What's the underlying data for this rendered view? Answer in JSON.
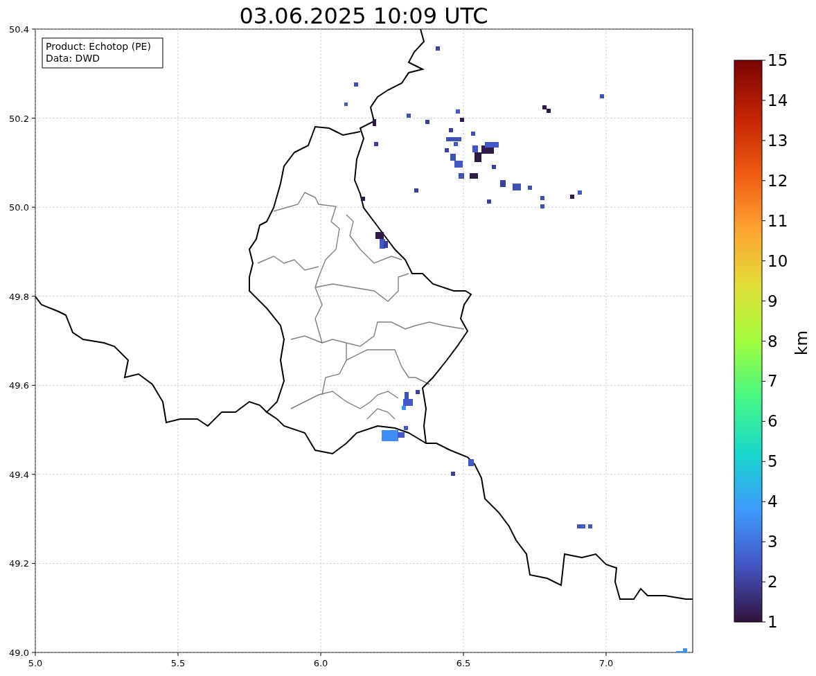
{
  "title": "03.06.2025 10:09 UTC",
  "info_box": [
    "Product: Echotop (PE)",
    "Data: DWD"
  ],
  "map": {
    "x_ticks": [
      "5.0",
      "5.5",
      "6.0",
      "6.5",
      "7.0"
    ],
    "y_ticks": [
      "50.4",
      "50.2",
      "50.0",
      "49.8",
      "49.6",
      "49.4",
      "49.2",
      "49.0"
    ]
  },
  "colorbar": {
    "ticks": [
      "15",
      "14",
      "13",
      "12",
      "11",
      "10",
      "9",
      "8",
      "7",
      "6",
      "5",
      "4",
      "3",
      "2",
      "1"
    ],
    "label": "km"
  }
}
